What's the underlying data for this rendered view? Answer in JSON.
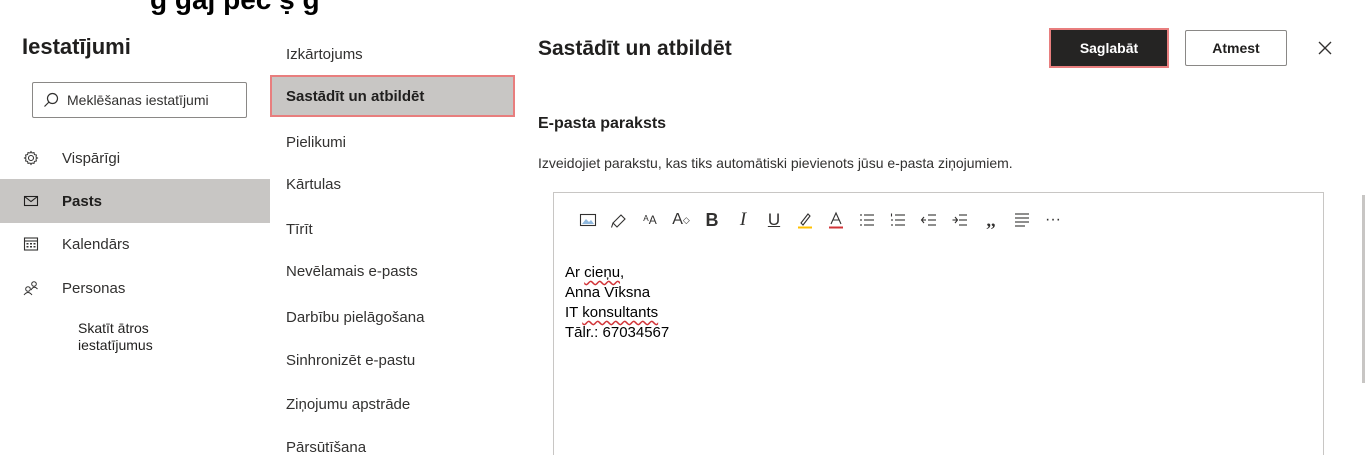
{
  "top_clip_text": "g                gaj                           pēc                                  ṣ  g",
  "settings": {
    "title": "Iestatījumi",
    "search_placeholder": "Meklēšanas iestatījumi",
    "nav": [
      {
        "label": "Vispārīgi",
        "icon": "gear-icon"
      },
      {
        "label": "Pasts",
        "icon": "mail-icon"
      },
      {
        "label": "Kalendārs",
        "icon": "calendar-icon"
      },
      {
        "label": "Personas",
        "icon": "people-icon"
      }
    ],
    "quick_settings": "Skatīt ātros iestatījumus"
  },
  "mail_sections": [
    "Izkārtojums",
    "Sastādīt un atbildēt",
    "Pielikumi",
    "Kārtulas",
    "Tīrīt",
    "Nevēlamais e-pasts",
    "Darbību pielāgošana",
    "Sinhronizēt e-pastu",
    "Ziņojumu apstrāde",
    "Pārsūtīšana"
  ],
  "panel": {
    "title": "Sastādīt un atbildēt",
    "save_label": "Saglabāt",
    "discard_label": "Atmest",
    "signature_heading": "E-pasta paraksts",
    "signature_description": "Izveidojiet parakstu, kas tiks automātiski pievienots jūsu e-pasta ziņojumiem.",
    "toolbar_icons": [
      "image-icon",
      "format-painter-icon",
      "font-size-icon",
      "font-grow-icon",
      "bold-icon",
      "italic-icon",
      "underline-icon",
      "highlight-icon",
      "font-color-icon",
      "bullets-icon",
      "numbering-icon",
      "decrease-indent-icon",
      "increase-indent-icon",
      "quote-icon",
      "align-icon",
      "more-icon"
    ],
    "signature": {
      "line1_prefix": "Ar ",
      "line1_word": "cieņu",
      "line1_suffix": ",",
      "line2": "Anna Vīksna",
      "line3_prefix": "IT ",
      "line3_word": "konsultants",
      "line4": "Tālr.: 67034567"
    }
  },
  "colors": {
    "highlight_border": "#e87e7e",
    "selected_bg": "#c8c6c4",
    "primary_button": "#252423"
  }
}
